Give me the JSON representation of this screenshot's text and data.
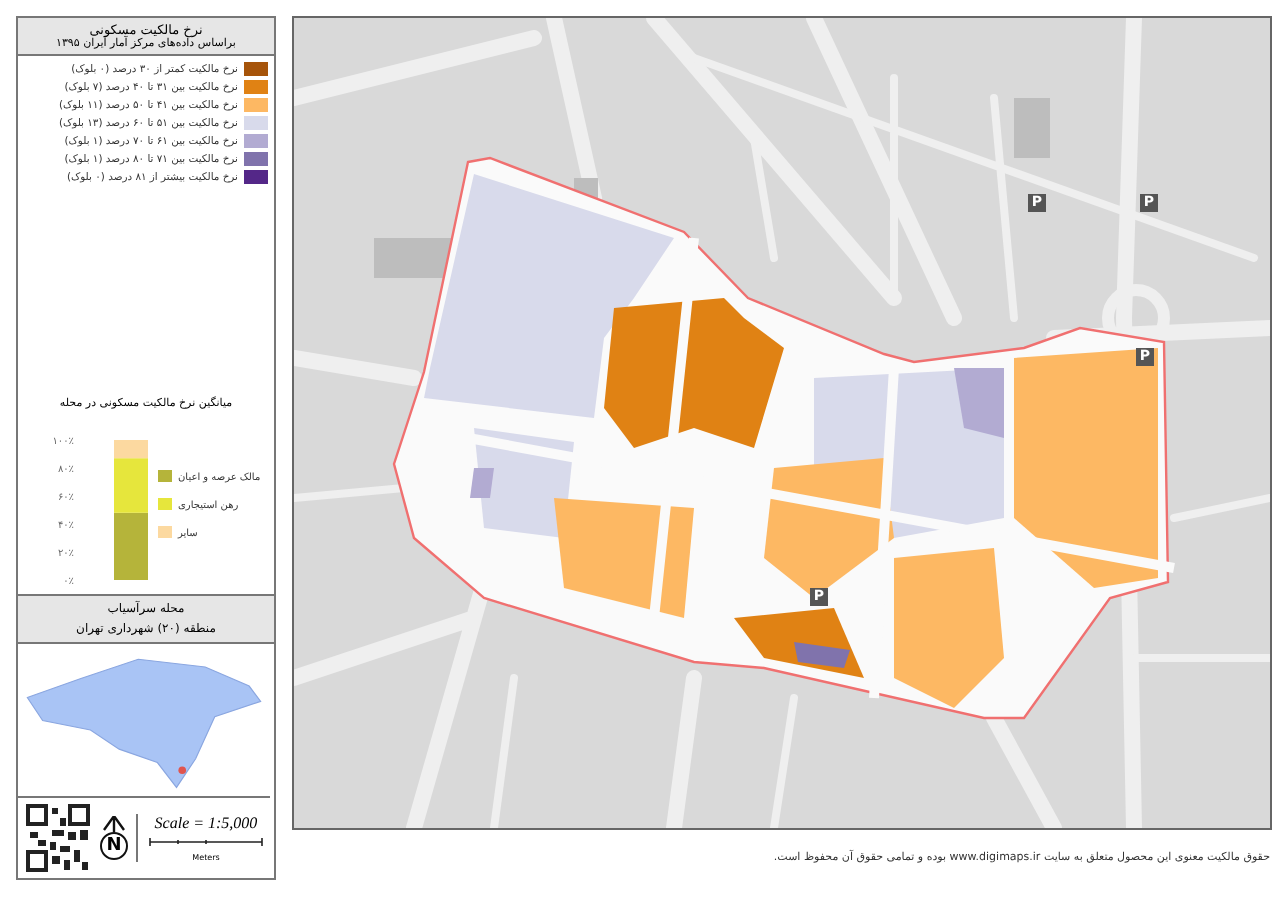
{
  "legend": {
    "title": "نرخ مالکیت مسکونی",
    "subtitle": "براساس داده‌های مرکز آمار ایران ۱۳۹۵",
    "items": [
      {
        "label": "نرخ مالکیت کمتر از ۳۰ درصد (۰ بلوک)",
        "color": "#a6540a"
      },
      {
        "label": "نرخ مالکیت بین ۳۱ تا ۴۰ درصد (۷ بلوک)",
        "color": "#e08214"
      },
      {
        "label": "نرخ مالکیت بین ۴۱ تا ۵۰ درصد (۱۱ بلوک)",
        "color": "#fdb863"
      },
      {
        "label": "نرخ مالکیت بین ۵۱ تا ۶۰ درصد (۱۳ بلوک)",
        "color": "#d8daeb"
      },
      {
        "label": "نرخ مالکیت بین ۶۱ تا ۷۰ درصد (۱ بلوک)",
        "color": "#b2abd2"
      },
      {
        "label": "نرخ مالکیت بین ۷۱ تا ۸۰ درصد (۱ بلوک)",
        "color": "#8073ac"
      },
      {
        "label": "نرخ مالکیت بیشتر از ۸۱ درصد (۰ بلوک)",
        "color": "#542788"
      }
    ]
  },
  "chart_data": {
    "type": "bar",
    "title": "میانگین نرخ مالکیت مسکونی در محله",
    "stacked": true,
    "legend": "right",
    "ylim": [
      0,
      100
    ],
    "yticks": [
      {
        "value": 0,
        "label": "۰٪"
      },
      {
        "value": 20,
        "label": "۲۰٪"
      },
      {
        "value": 40,
        "label": "۴۰٪"
      },
      {
        "value": 60,
        "label": "۶۰٪"
      },
      {
        "value": 80,
        "label": "۸۰٪"
      },
      {
        "value": 100,
        "label": "۱۰۰٪"
      }
    ],
    "series": [
      {
        "name": "مالک عرصه و اعیان",
        "color": "#b5b43a",
        "values": [
          48
        ]
      },
      {
        "name": "رهن استیجاری",
        "color": "#e6e63c",
        "values": [
          39
        ]
      },
      {
        "name": "سایر",
        "color": "#fcd9a0",
        "values": [
          13
        ]
      }
    ]
  },
  "locator": {
    "neighbourhood": "محله سرآسیاب",
    "district": "منطقه (۲۰) شهرداری تهران"
  },
  "north_label": "N",
  "scale": "Scale = 1:5,000",
  "scale_unit": "Meters",
  "parking_signs": [
    "P",
    "P",
    "P",
    "P"
  ],
  "footer": "حقوق مالکیت معنوی این محصول متعلق به سایت www.digimaps.ir بوده و تمامی حقوق آن محفوظ است."
}
